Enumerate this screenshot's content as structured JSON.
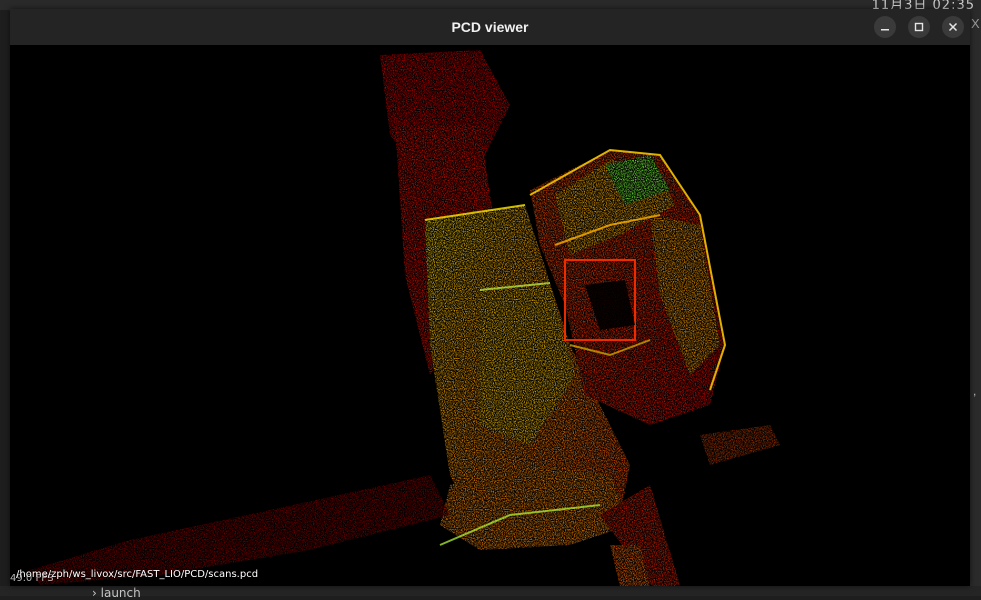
{
  "window": {
    "title": "PCD viewer",
    "buttons": {
      "minimize_icon": "minimize-icon",
      "maximize_icon": "maximize-icon",
      "close_icon": "close-icon"
    }
  },
  "viewer": {
    "file_path": "/home/zph/ws_livox/src/FAST_LIO/PCD/scans.pcd",
    "fps_text": "49.0 FPS",
    "background_color": "#000000",
    "point_colors": [
      "#ff2a00",
      "#ff6a00",
      "#ffa500",
      "#ffe000",
      "#9cff3a",
      "#3cff6a",
      "#d40000"
    ]
  },
  "background": {
    "top_right_text": "11月3日 02:35",
    "bottom_text": "launch",
    "right_edge_text": "X"
  }
}
